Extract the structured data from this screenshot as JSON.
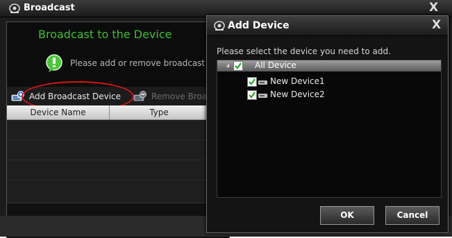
{
  "main_window": {
    "title": "Broadcast",
    "close_glyph": "X",
    "heading": "Broadcast to the Device",
    "hint": "Please add or remove broadcast",
    "toolbar": {
      "add_label": "Add Broadcast Device",
      "remove_label": "Remove Broac"
    },
    "table": {
      "columns": [
        "Device Name",
        "Type"
      ],
      "rows": []
    },
    "annotation_color": "#d81515"
  },
  "dialog": {
    "title": "Add Device",
    "close_glyph": "X",
    "prompt": "Please select the device you need to add.",
    "tree": {
      "root": {
        "label": "All Device",
        "checked": true,
        "expanded": true
      },
      "children": [
        {
          "label": "New Device1",
          "checked": true,
          "icon": "camera-icon"
        },
        {
          "label": "New Device2",
          "checked": true,
          "icon": "camera-icon"
        }
      ]
    },
    "buttons": {
      "ok": "OK",
      "cancel": "Cancel"
    }
  },
  "colors": {
    "accent_green": "#3fbf34",
    "check_green": "#2ca82c"
  }
}
